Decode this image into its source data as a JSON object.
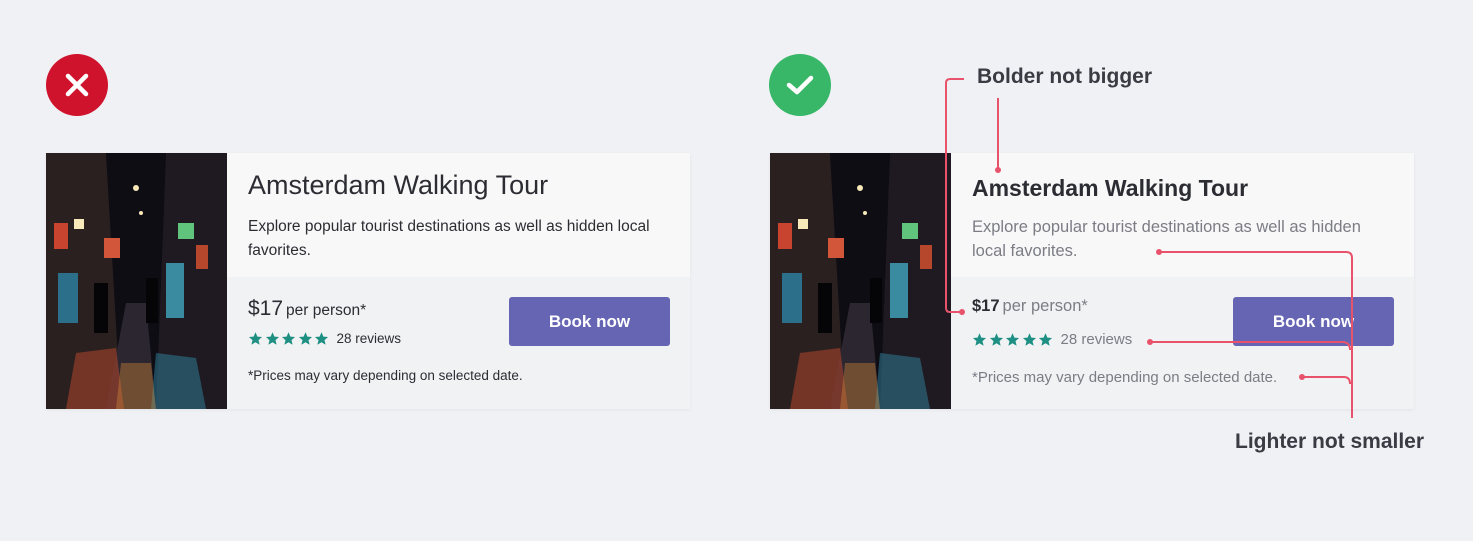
{
  "colors": {
    "bad": "#d0132c",
    "good": "#39b768",
    "button": "#6665b3",
    "star": "#1d8f83",
    "annotation_line": "#e8536b"
  },
  "icons": {
    "bad_badge": "x-icon",
    "good_badge": "check-icon",
    "rating": "star-icon"
  },
  "card": {
    "title": "Amsterdam Walking Tour",
    "description": "Explore popular tourist destinations as well as hidden local favorites.",
    "price": "$17",
    "price_suffix": "per person*",
    "rating": 5,
    "reviews": "28 reviews",
    "note": "*Prices may vary depending on selected date.",
    "button_label": "Book now"
  },
  "annotations": {
    "bolder": "Bolder not bigger",
    "lighter": "Lighter not smaller"
  }
}
